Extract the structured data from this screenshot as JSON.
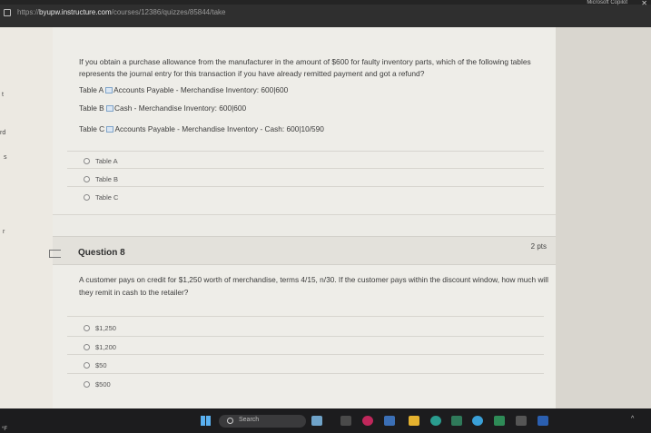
{
  "browser": {
    "url_scheme": "https://",
    "url_host": "byupw.instructure.com",
    "url_path": "/courses/12386/quizzes/85844/take",
    "copilot_label": "Microsoft Copilot",
    "close_glyph": "✕"
  },
  "sidebar": {
    "fragments": [
      "t",
      "rd",
      "s",
      "r"
    ]
  },
  "question7": {
    "text": "If you obtain a purchase allowance from the manufacturer in the amount of $600 for faulty inventory parts, which of the following tables represents the journal entry for this transaction if you have already remitted payment and got a refund?",
    "tables": [
      {
        "prefix": "Table A",
        "description": "Accounts Payable - Merchandise Inventory: 600|600"
      },
      {
        "prefix": "Table B",
        "description": "Cash - Merchandise Inventory: 600|600"
      },
      {
        "prefix": "Table C",
        "description": "Accounts Payable - Merchandise Inventory - Cash: 600|10/590"
      }
    ],
    "options": [
      "Table A",
      "Table B",
      "Table C"
    ]
  },
  "question8": {
    "title": "Question 8",
    "points": "2 pts",
    "text": "A customer pays on credit for $1,250 worth of merchandise, terms 4/15, n/30. If the customer pays within the discount window, how much will they remit in cash to the retailer?",
    "options": [
      "$1,250",
      "$1,200",
      "$50",
      "$500"
    ]
  },
  "taskbar": {
    "temperature_fragment": "°F",
    "search_label": "Search"
  },
  "colors": {
    "chrome": "#2f2f2f",
    "panel": "#eeede8",
    "taskbar": "#1c1c1e"
  }
}
